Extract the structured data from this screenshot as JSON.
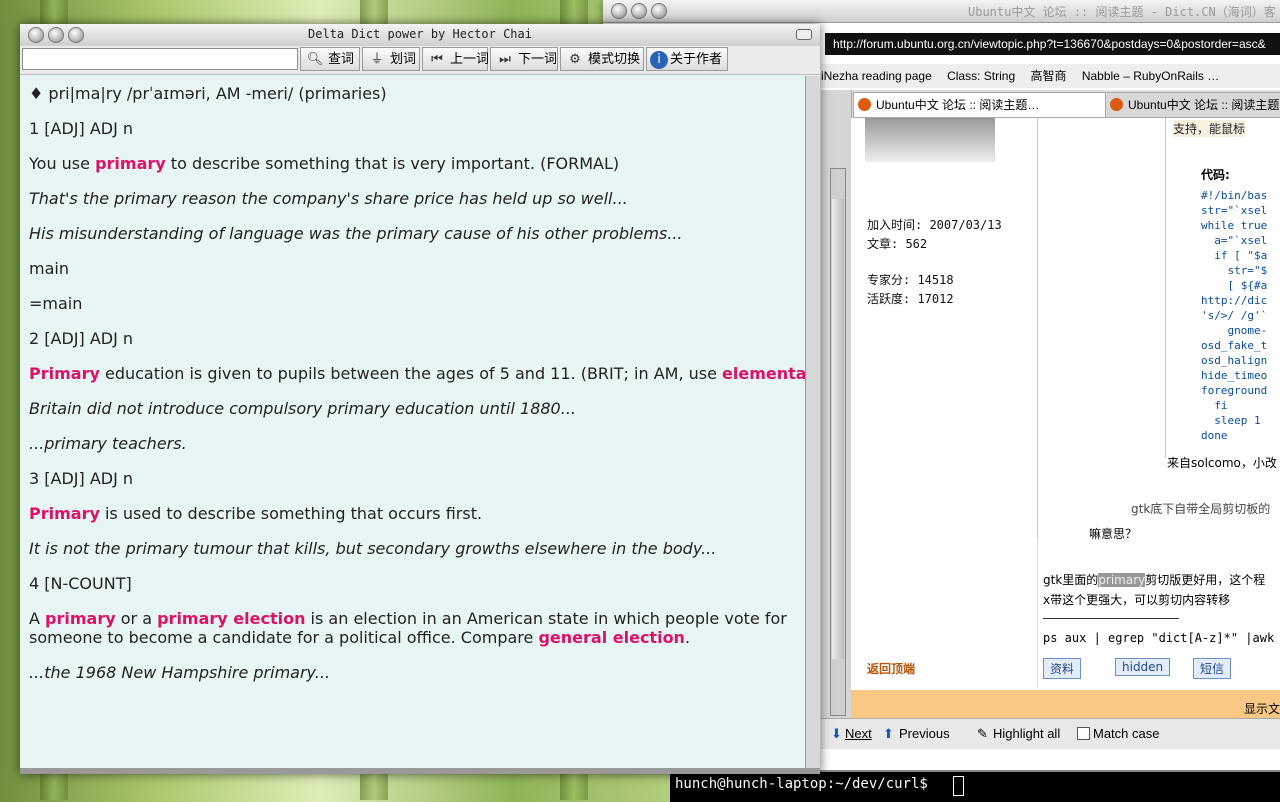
{
  "dict": {
    "title": "Delta Dict power by Hector Chai",
    "search_value": "",
    "toolbar": {
      "lookup": "查词",
      "select": "划词",
      "prev": "上一词",
      "next": "下一词",
      "mode": "模式切换",
      "about": "关于作者"
    },
    "entry": {
      "headword": "♦ pri|ma|ry /prˈaɪməri, AM -meri/ (primaries)",
      "s1": "1 [ADJ] ADJ n",
      "s1_def_a": "You use ",
      "s1_def_hl": "primary",
      "s1_def_b": " to describe something that is very important. (FORMAL)",
      "s1_ex1": "That's the primary reason the company's share price has held up so well...",
      "s1_ex2": "His misunderstanding of language was the primary cause of his other problems...",
      "syn": "main",
      "syn2": "=main",
      "s2": "2 [ADJ] ADJ n",
      "s2_hl": "Primary",
      "s2_def": " education is given to pupils between the ages of 5 and 11. (BRIT; in AM, use ",
      "s2_hl2": "elementary",
      "s2_end": ")",
      "s2_ex1": "Britain did not introduce compulsory primary education until 1880...",
      "s2_ex2": "...primary teachers.",
      "s3": "3 [ADJ] ADJ n",
      "s3_hl": "Primary",
      "s3_def": " is used to describe something that occurs first.",
      "s3_ex1": "It is not the primary tumour that kills, but secondary growths elsewhere in the body...",
      "s4": "4 [N-COUNT]",
      "s4_a": "A ",
      "s4_hl1": "primary",
      "s4_b": " or a ",
      "s4_hl2": "primary election",
      "s4_c": " is an election in an American state in which people vote for",
      "s4_d": "someone to become a candidate for a political office. Compare ",
      "s4_hl3": "general election",
      "s4_e": ".",
      "s4_ex1": "...the 1968 New Hampshire primary..."
    }
  },
  "browser": {
    "title": "Ubuntu中文 论坛 :: 阅读主题 - Dict.CN（海词）客",
    "url": "http://forum.ubuntu.org.cn/viewtopic.php?t=136670&postdays=0&postorder=asc&",
    "bookmarks": [
      "iNezha reading page",
      "Class: String",
      "高智商",
      "Nabble – RubyOnRails …"
    ],
    "tab1": "Ubuntu中文 论坛 :: 阅读主题…",
    "tab2": "Ubuntu中文 论坛 :: 阅读主题",
    "profile": {
      "join": "加入时间: 2007/03/13",
      "posts": "文章: 562",
      "expert": "专家分: 14518",
      "active": "活跃度: 17012"
    },
    "post": {
      "support": "支持，能鼠标",
      "code_label": "代码:",
      "code": "#!/bin/bas\nstr=\"`xsel\nwhile true\n  a=\"`xsel\n  if [ \"$a\n    str=\"$\n    [ ${#a\nhttp://dic\n's/>/ /g'`\n    gnome-\nosd_fake_t\nosd_halign\nhide_timeo\nforeground\n  fi\n  sleep 1\ndone",
      "from": "来自solcomo，小改",
      "gtk_note": "gtk底下自带全局剪切板的",
      "question": "嘛意思？",
      "reply_a": "gtk里面的",
      "reply_hl": "primary",
      "reply_b": "剪切版更好用，这个程",
      "reply_c": "x带这个更强大，可以剪切内容转移",
      "sig": "ps aux | egrep \"dict[A-z]*\" |awk '{p",
      "back_top": "返回顶端",
      "btn_profile": "资料",
      "btn_hidden": "hidden",
      "btn_pm": "短信",
      "show": "显示文"
    },
    "find": {
      "next": "Next",
      "previous": "Previous",
      "highlight": "Highlight all",
      "match": "Match case"
    }
  },
  "terminal": {
    "prompt": "hunch@hunch-laptop:~/dev/curl$ "
  }
}
